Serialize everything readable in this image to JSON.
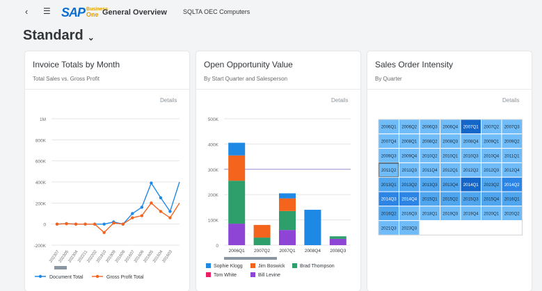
{
  "header": {
    "logo_text": "SAP",
    "logo_sub_line1": "Business",
    "logo_sub_line2": "One",
    "page_name": "General Overview",
    "company": "SQLTA OEC Computers",
    "variant": "Standard"
  },
  "colors": {
    "brand": "#0a6ed1",
    "series_blue": "#1e88e5",
    "series_orange": "#f4641d",
    "series_green": "#2e9e6a",
    "series_pink": "#e91e63",
    "series_purple": "#8e44d4"
  },
  "cards": [
    {
      "title": "Invoice Totals by Month",
      "subtitle": "Total Sales vs. Gross Profit",
      "details": "Details"
    },
    {
      "title": "Open Opportunity Value",
      "subtitle": "By Start Quarter and Salesperson",
      "details": "Details"
    },
    {
      "title": "Sales Order Intensity",
      "subtitle": "By Quarter",
      "details": "Details"
    }
  ],
  "chart_data": [
    {
      "type": "line",
      "title": "Invoice Totals by Month",
      "subtitle": "Total Sales vs. Gross Profit",
      "categories": [
        "202307",
        "202305",
        "202304",
        "202211",
        "202202",
        "201910",
        "201909",
        "201608",
        "201607",
        "201606",
        "201605",
        "201604",
        "201603"
      ],
      "y_ticks": [
        "1M",
        "800K",
        "600K",
        "400K",
        "200K",
        "0",
        "-200K"
      ],
      "ylim": [
        -200000,
        1000000
      ],
      "series": [
        {
          "name": "Document Total",
          "color": "#1e88e5",
          "values": [
            0,
            5000,
            0,
            0,
            0,
            0,
            20000,
            0,
            100000,
            160000,
            390000,
            250000,
            120000,
            400000
          ]
        },
        {
          "name": "Gross Profit Total",
          "color": "#f4641d",
          "values": [
            0,
            3000,
            0,
            0,
            0,
            -80000,
            10000,
            0,
            60000,
            80000,
            200000,
            120000,
            60000,
            200000
          ]
        }
      ],
      "legend": "bottom",
      "grid": true
    },
    {
      "type": "bar",
      "stacked": true,
      "title": "Open Opportunity Value",
      "subtitle": "By Start Quarter and Salesperson",
      "categories": [
        "2006Q1",
        "2007Q2",
        "2007Q1",
        "2008Q4",
        "2008Q3"
      ],
      "y_ticks": [
        "500K",
        "400K",
        "300K",
        "200K",
        "100K",
        "0"
      ],
      "ylim": [
        0,
        500000
      ],
      "series": [
        {
          "name": "Sophie Klogg",
          "color": "#1e88e5",
          "values": [
            50000,
            0,
            20000,
            140000,
            0
          ]
        },
        {
          "name": "Jim Boswick",
          "color": "#f4641d",
          "values": [
            100000,
            50000,
            50000,
            0,
            0
          ]
        },
        {
          "name": "Brad Thompson",
          "color": "#2e9e6a",
          "values": [
            170000,
            30000,
            75000,
            0,
            10000
          ]
        },
        {
          "name": "Tom White",
          "color": "#e91e63",
          "values": [
            0,
            0,
            0,
            0,
            0
          ]
        },
        {
          "name": "Bill Levine",
          "color": "#8e44d4",
          "values": [
            85000,
            0,
            60000,
            0,
            25000
          ]
        }
      ],
      "legend": "bottom",
      "grid": true
    },
    {
      "type": "heatmap",
      "title": "Sales Order Intensity",
      "subtitle": "By Quarter",
      "cells": [
        [
          "2006Q1",
          "2006Q2",
          "2006Q3",
          "2006Q4",
          "2007Q1",
          "2007Q2",
          "2007Q3"
        ],
        [
          "2007Q4",
          "2008Q1",
          "2008Q2",
          "2008Q3",
          "2008Q4",
          "2009Q1",
          "2009Q2"
        ],
        [
          "2009Q3",
          "2009Q4",
          "2010Q2",
          "2010Q1",
          "2010Q3",
          "2010Q4",
          "2011Q1"
        ],
        [
          "2011Q2",
          "2011Q3",
          "2011Q4",
          "2012Q1",
          "2012Q2",
          "2012Q3",
          "2012Q4"
        ],
        [
          "2013Q1",
          "2013Q2",
          "2013Q3",
          "2013Q4",
          "2014Q1",
          "2023Q2",
          "2014Q2"
        ],
        [
          "2014Q3",
          "2014Q4",
          "2015Q1",
          "2015Q2",
          "2015Q3",
          "2015Q4",
          "2016Q1"
        ],
        [
          "2016Q2",
          "2016Q3",
          "2018Q1",
          "2019Q3",
          "2019Q4",
          "2020Q1",
          "2020Q2"
        ],
        [
          "2021Q3",
          "2023Q3",
          "",
          "",
          "",
          "",
          ""
        ]
      ],
      "intensity": [
        [
          1,
          1,
          1,
          1,
          4,
          1,
          1
        ],
        [
          1,
          1,
          1,
          1,
          1,
          1,
          1
        ],
        [
          1,
          1,
          1,
          1,
          1,
          1,
          1
        ],
        [
          1,
          1,
          1,
          1,
          1,
          1,
          1
        ],
        [
          2,
          2,
          2,
          2,
          4,
          2,
          3
        ],
        [
          3,
          3,
          2,
          2,
          2,
          2,
          2
        ],
        [
          2,
          1,
          1,
          1,
          1,
          1,
          1
        ],
        [
          1,
          1,
          0,
          0,
          0,
          0,
          0
        ]
      ],
      "selected": "2011Q2"
    }
  ]
}
